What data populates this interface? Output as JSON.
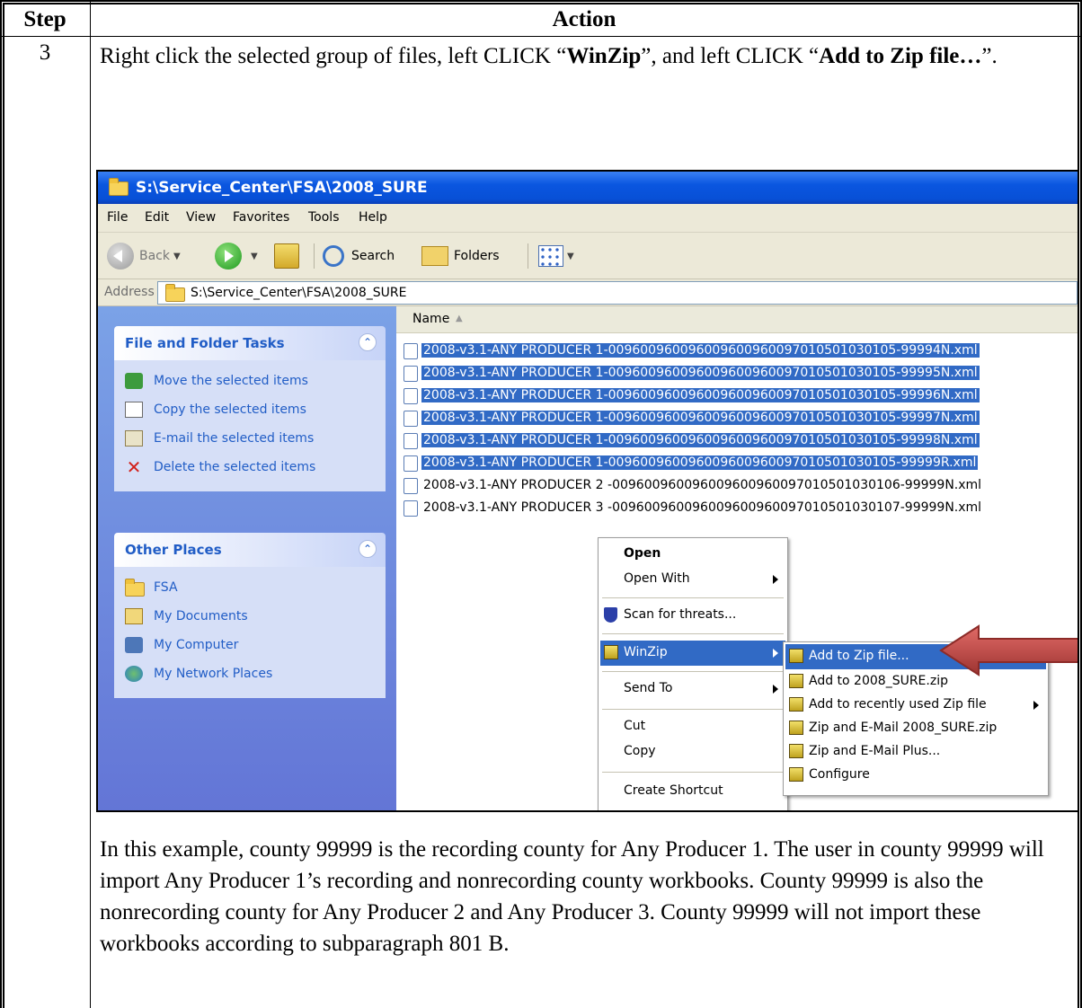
{
  "table": {
    "header_step": "Step",
    "header_action": "Action",
    "step_number": "3",
    "instruction_pre": "Right click the selected group of files, left CLICK “",
    "instruction_bold1": "WinZip",
    "instruction_mid": "”, and left CLICK “",
    "instruction_bold2": "Add to Zip file…",
    "instruction_post": "”.",
    "paragraph": "In this example, county 99999 is the recording county for Any Producer 1.  The user in county 99999 will import Any Producer 1’s recording and nonrecording county workbooks. County 99999 is also the nonrecording county for Any Producer 2 and Any Producer 3.  County 99999 will not import these workbooks according to subparagraph 801 B."
  },
  "window": {
    "title": "S:\\Service_Center\\FSA\\2008_SURE",
    "menu": [
      "File",
      "Edit",
      "View",
      "Favorites",
      "Tools",
      "Help"
    ],
    "toolbar": {
      "back": "Back",
      "search": "Search",
      "folders": "Folders"
    },
    "address_label": "Address",
    "address_value": "S:\\Service_Center\\FSA\\2008_SURE"
  },
  "task_pane": {
    "file_tasks": {
      "title": "File and Folder Tasks",
      "items": [
        "Move the selected items",
        "Copy the selected items",
        "E-mail the selected items",
        "Delete the selected items"
      ]
    },
    "other_places": {
      "title": "Other Places",
      "items": [
        "FSA",
        "My Documents",
        "My Computer",
        "My Network Places"
      ]
    }
  },
  "file_list": {
    "column_name": "Name",
    "files": [
      "2008-v3.1-ANY PRODUCER 1-009600960096009600960097010501030105-99994N.xml",
      "2008-v3.1-ANY PRODUCER 1-009600960096009600960097010501030105-99995N.xml",
      "2008-v3.1-ANY PRODUCER 1-009600960096009600960097010501030105-99996N.xml",
      "2008-v3.1-ANY PRODUCER 1-009600960096009600960097010501030105-99997N.xml",
      "2008-v3.1-ANY PRODUCER 1-009600960096009600960097010501030105-99998N.xml",
      "2008-v3.1-ANY PRODUCER 1-009600960096009600960097010501030105-99999R.xml",
      "2008-v3.1-ANY PRODUCER 2 -009600960096009600960097010501030106-99999N.xml",
      "2008-v3.1-ANY PRODUCER 3 -009600960096009600960097010501030107-99999N.xml"
    ],
    "selected_count": 6
  },
  "context_menu": {
    "items": [
      "Open",
      "Open With",
      "Scan for threats...",
      "WinZip",
      "Send To",
      "Cut",
      "Copy",
      "Create Shortcut"
    ]
  },
  "winzip_submenu": {
    "items": [
      "Add to Zip file...",
      "Add to 2008_SURE.zip",
      "Add to recently used Zip file",
      "Zip and E-Mail 2008_SURE.zip",
      "Zip and E-Mail Plus...",
      "Configure"
    ]
  },
  "colors": {
    "title_bar": "#0a56e0",
    "selection": "#316ac5",
    "task_pane": "#6f8fe0",
    "arrow": "#c0504d"
  }
}
